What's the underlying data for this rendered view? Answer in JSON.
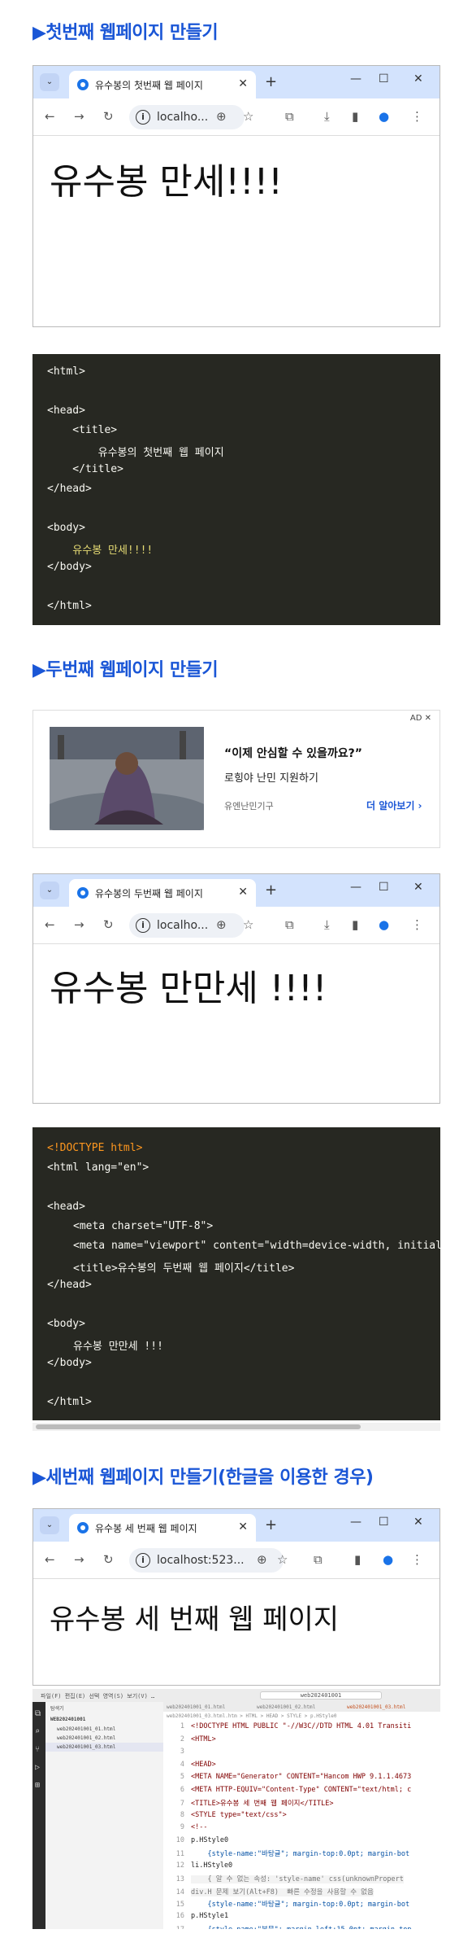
{
  "section1": {
    "title": "▶첫번째 웹페이지 만들기"
  },
  "browser1": {
    "tab_title": "유수봉의 첫번째 웹 페이지",
    "url": "localho...",
    "content": "유수봉 만세!!!!"
  },
  "code1": {
    "lines": [
      "<html>",
      "",
      "<head>",
      "    <title>",
      "        유수봉의 첫번째 웹 페이지",
      "    </title>",
      "</head>",
      "",
      "<body>",
      "    유수봉 만세!!!!",
      "</body>",
      "",
      "</html>"
    ]
  },
  "section2": {
    "title": "▶두번째 웹페이지 만들기"
  },
  "ad": {
    "badge": "AD ✕",
    "headline": "“이제 안심할 수 있을까요?”",
    "subline": "로힝야 난민 지원하기",
    "sponsor": "유엔난민기구",
    "cta": "더 알아보기 ›"
  },
  "browser2": {
    "tab_title": "유수봉의 두번째 웹 페이지",
    "url": "localho...",
    "content": "유수봉 만만세 !!!!"
  },
  "code2": {
    "doctype": "<!DOCTYPE html>",
    "html_open": "<html lang=\"en\">",
    "head_open": "<head>",
    "meta_charset": "<meta charset=\"UTF-8\">",
    "meta_viewport": "<meta name=\"viewport\" content=\"width=device-width, initial",
    "title_line": "<title>유수봉의 두번째 웹 페이지</title>",
    "head_close": "</head>",
    "body_open": "<body>",
    "body_text": "유수봉 만만세 !!!",
    "body_close": "</body>",
    "html_close": "</html>"
  },
  "section3": {
    "title": "▶세번째 웹페이지 만들기(한글을 이용한 경우)"
  },
  "browser3": {
    "tab_title": "유수봉 세 번째 웹 페이지",
    "url": "localhost:523...",
    "content": "유수봉 세 번째 웹 페이지"
  },
  "vscode": {
    "search": "web202401001",
    "explorer_title": "탐색기",
    "folder": "WEB202401001",
    "files": [
      "web202401001_01.html",
      "web202401001_02.html",
      "web202401001_03.html"
    ],
    "tabs": [
      "web202401001_01.html",
      "web202401001_02.html",
      "web202401001_03.html"
    ],
    "breadcrumb": "web202401001_03.html.htm > HTML > HEAD > STYLE > p.HStyle0",
    "lines": [
      "<!DOCTYPE HTML PUBLIC \"-//W3C//DTD HTML 4.01 Transiti",
      "<HTML>",
      "",
      "<HEAD>",
      "<META NAME=\"Generator\" CONTENT=\"Hancom HWP 9.1.1.4673",
      "<META HTTP-EQUIV=\"Content-Type\" CONTENT=\"text/html; c",
      "<TITLE>유수봉 세 번째 웹 페이지</TITLE>",
      "<STYLE type=\"text/css\">",
      "<!--",
      "p.HStyle0",
      "    {style-name:\"바탕글\"; margin-top:0.0pt; margin-bot",
      "li.HStyle0",
      "    { 알 수 없는 속성: 'style-name' css(unknownPropert",
      "div.H 문제 보기(Alt+F8)  빠른 수정을 사용할 수 없음",
      "    {style-name:\"바탕글\"; margin-top:0.0pt; margin-bot",
      "p.HStyle1",
      "    {style-name:\"본문\"; margin-left:15.0pt; margin-top"
    ]
  }
}
